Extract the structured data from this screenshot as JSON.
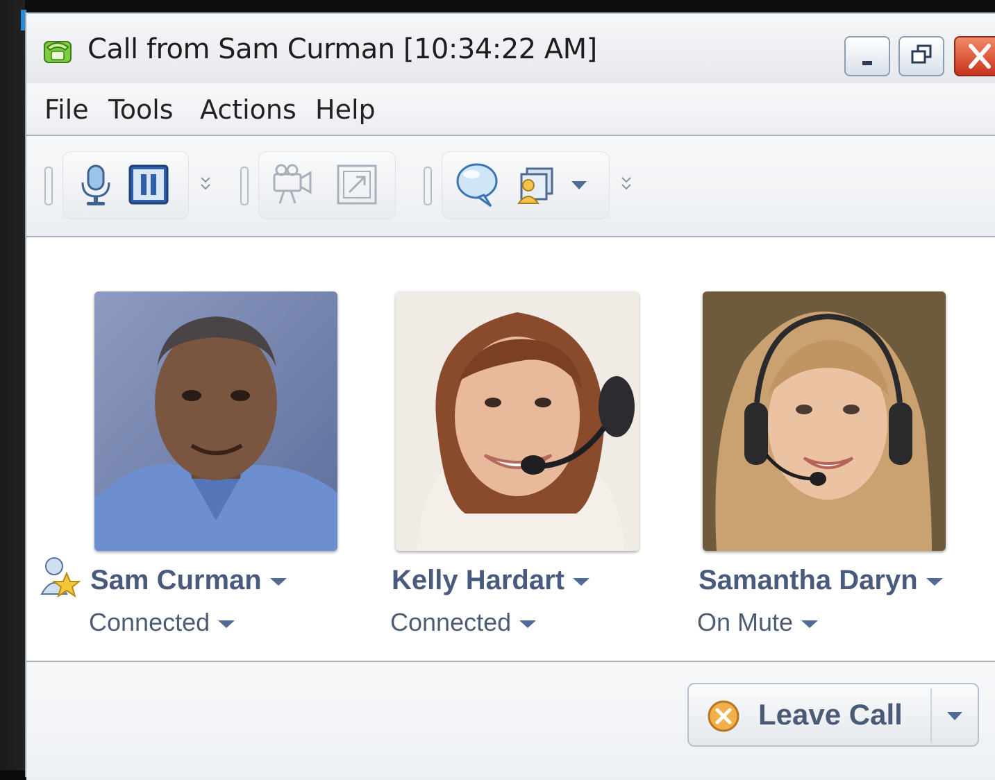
{
  "window": {
    "title": "Call from Sam Curman [10:34:22 AM]"
  },
  "menu": {
    "file": "File",
    "tools": "Tools",
    "actions": "Actions",
    "help": "Help"
  },
  "toolbar": {
    "icons": [
      "microphone-icon",
      "pause-icon",
      "video-camera-icon",
      "screen-share-icon",
      "chat-icon",
      "contact-card-icon"
    ]
  },
  "participants": [
    {
      "name": "Sam Curman",
      "status": "Connected",
      "is_moderator": true
    },
    {
      "name": "Kelly Hardart",
      "status": "Connected",
      "is_moderator": false
    },
    {
      "name": "Samantha Daryn",
      "status": "On Mute",
      "is_moderator": false
    }
  ],
  "footer": {
    "leave_label": "Leave Call"
  },
  "colors": {
    "name_text": "#4a5a7c",
    "accent_blue": "#526b96",
    "close_red": "#c9331b"
  }
}
